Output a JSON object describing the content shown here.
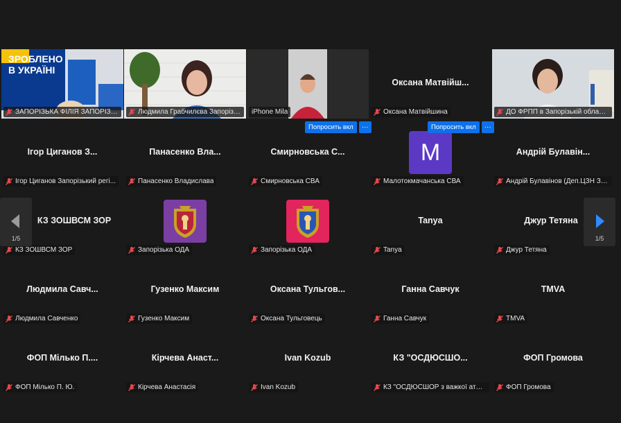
{
  "navigation": {
    "page_left": "1/5",
    "page_right": "1/5"
  },
  "ask_button_label": "Попросить вкл",
  "more_button_label": "···",
  "video_tiles": [
    {
      "label": "ЗАПОРІЗЬКА ФІЛІЯ ЗАПОРІЗЬКО...",
      "sign_line1": "ЗРОБЛЕНО",
      "sign_line2": "В УКРАЇНІ"
    },
    {
      "label": "Людмила Грабчилєва Запорізь..."
    },
    {
      "label": "iPhone Mila"
    },
    {
      "label": "Оксана Матвійшина",
      "name": "Оксана Матвійш..."
    },
    {
      "label": "ДО ФРПП в Запорізькій областi..."
    }
  ],
  "rows": [
    [
      {
        "name": "Ігор Циганов З...",
        "label": "Ігор Циганов Запорізький регі..."
      },
      {
        "name": "Панасенко Вла...",
        "label": "Панасенко Владислава"
      },
      {
        "name": "Смирновська С...",
        "label": "Смирновська СВА"
      },
      {
        "name": "",
        "label": "Малотокмачанська СВА",
        "avatar_letter": "M"
      },
      {
        "name": "Андрій Булавін...",
        "label": "Андрій Булавінов (Деп.ЦЗН Зап..."
      }
    ],
    [
      {
        "name": "КЗ ЗОШВСМ ЗОР",
        "label": "КЗ ЗОШВСМ ЗОР"
      },
      {
        "name": "",
        "label": "Запорізька ОДА"
      },
      {
        "name": "",
        "label": "Запорізька ОДА"
      },
      {
        "name": "Tanya",
        "label": "Tanya"
      },
      {
        "name": "Джур Тетяна",
        "label": "Джур Тетяна"
      }
    ],
    [
      {
        "name": "Людмила Савч...",
        "label": "Людмила Савченко"
      },
      {
        "name": "Гузенко Максим",
        "label": "Гузенко Максим"
      },
      {
        "name": "Оксана Тульгов...",
        "label": "Оксана Тульговець"
      },
      {
        "name": "Ганна Савчук",
        "label": "Ганна Савчук"
      },
      {
        "name": "TMVA",
        "label": "TMVA"
      }
    ],
    [
      {
        "name": "ФОП Мілько П....",
        "label": "ФОП Мілько П. Ю."
      },
      {
        "name": "Кірчева Анаст...",
        "label": "Кірчева Анастасія"
      },
      {
        "name": "Ivan Kozub",
        "label": "Ivan Kozub"
      },
      {
        "name": "КЗ \"ОСДЮСШО...",
        "label": "КЗ \"ОСДЮСШОР з важкої атле..."
      },
      {
        "name": "ФОП Громова",
        "label": "ФОП Громова"
      }
    ]
  ],
  "colors": {
    "background": "#1a1a1a",
    "active_border": "#22c55e",
    "button_blue": "#0e71eb",
    "avatar_purple": "#5c39c5"
  }
}
